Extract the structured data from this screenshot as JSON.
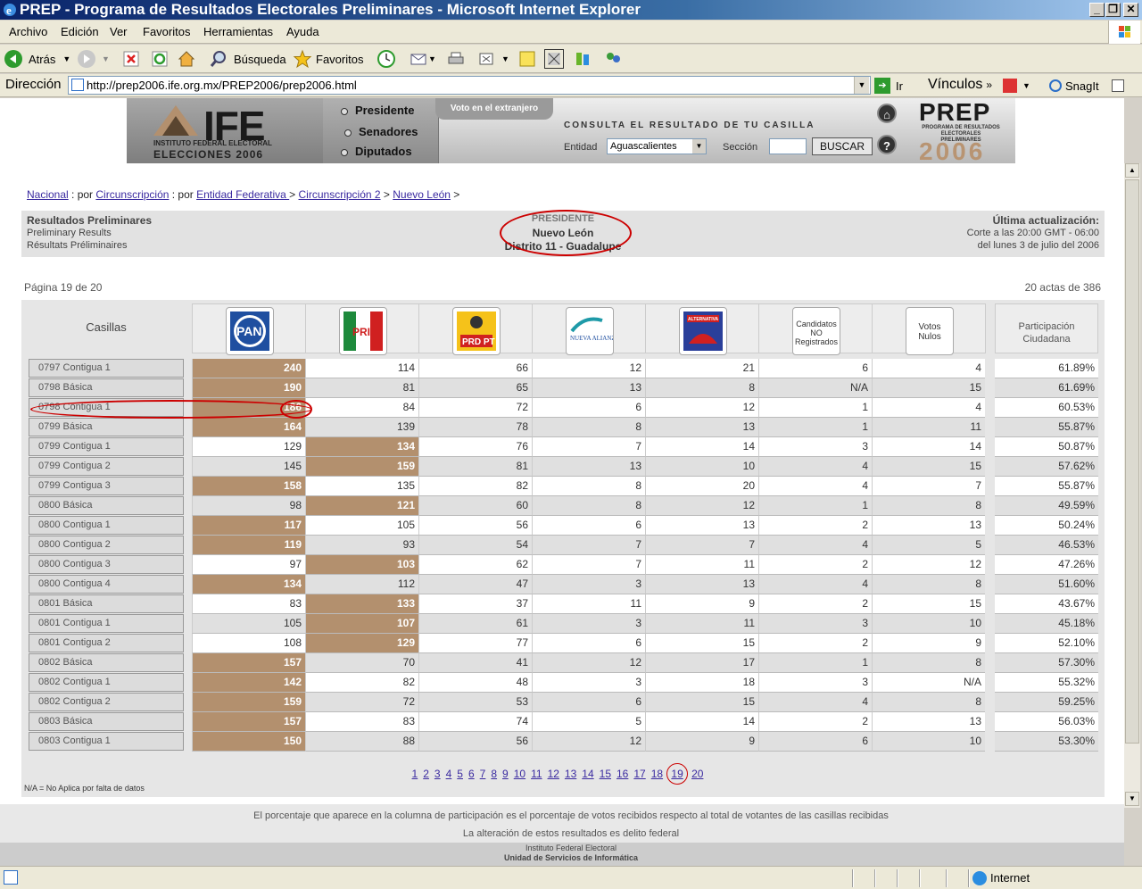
{
  "window": {
    "title": "PREP - Programa de Resultados Electorales Preliminares - Microsoft Internet Explorer"
  },
  "menu": [
    "Archivo",
    "Edición",
    "Ver",
    "Favoritos",
    "Herramientas",
    "Ayuda"
  ],
  "toolbar": {
    "back": "Atrás",
    "search": "Búsqueda",
    "favorites": "Favoritos",
    "go": "Ir",
    "links": "Vínculos",
    "snagit": "SnagIt"
  },
  "address": {
    "label": "Dirección",
    "url": "http://prep2006.ife.org.mx/PREP2006/prep2006.html"
  },
  "banner": {
    "logo": "IFE",
    "logo_sub": "INSTITUTO FEDERAL ELECTORAL",
    "logo_year": "ELECCIONES 2006",
    "nav": [
      "Presidente",
      "Senadores",
      "Diputados"
    ],
    "voto_tab": "Voto en el extranjero",
    "consulta": "CONSULTA EL RESULTADO DE TU CASILLA",
    "entidad_label": "Entidad",
    "entidad_value": "Aguascalientes",
    "seccion_label": "Sección",
    "buscar": "BUSCAR",
    "prep": "PREP",
    "prep_sub": "PROGRAMA DE RESULTADOS ELECTORALES PRELIMINARES",
    "prep_year": "2006"
  },
  "breadcrumb": {
    "nacional": "Nacional",
    "por1": " : por ",
    "circ": "Circunscripción",
    "por2": " : por ",
    "entidad": "Entidad Federativa ",
    "sep1": " > ",
    "circ2": "Circunscripción 2",
    "sep2": " > ",
    "estado": "Nuevo León",
    "sep3": " >"
  },
  "info": {
    "left1": "Resultados Preliminares",
    "left2": "Preliminary Results",
    "left3": "Résultats Préliminaires",
    "center1": "PRESIDENTE",
    "center2": "Nuevo León",
    "center3": "Distrito 11 - Guadalupe",
    "right1": "Última actualización:",
    "right2": "Corte a las 20:00 GMT - 06:00",
    "right3": "del lunes 3 de julio del 2006"
  },
  "pagina": "Página 19 de 20",
  "actas": "20 actas de 386",
  "table": {
    "casillas_header": "Casillas",
    "party_text_headers": [
      "Candidatos NO Registrados",
      "Votos Nulos"
    ],
    "participacion_header": "Participación Ciudadana",
    "party_logos": [
      "PAN",
      "PRI",
      "PRD PT",
      "NUEVA ALIANZA",
      "ALTERNATIVA"
    ],
    "rows": [
      {
        "casilla": "0797 Contigua 1",
        "v": [
          "240",
          "114",
          "66",
          "12",
          "21",
          "6",
          "4"
        ],
        "win": 0,
        "p": "61.89%"
      },
      {
        "casilla": "0798 Básica",
        "v": [
          "190",
          "81",
          "65",
          "13",
          "8",
          "N/A",
          "15"
        ],
        "win": 0,
        "p": "61.69%"
      },
      {
        "casilla": "0798 Contigua 1",
        "v": [
          "186",
          "84",
          "72",
          "6",
          "12",
          "1",
          "4"
        ],
        "win": 0,
        "p": "60.53%"
      },
      {
        "casilla": "0799 Básica",
        "v": [
          "164",
          "139",
          "78",
          "8",
          "13",
          "1",
          "11"
        ],
        "win": 0,
        "p": "55.87%"
      },
      {
        "casilla": "0799 Contigua 1",
        "v": [
          "129",
          "134",
          "76",
          "7",
          "14",
          "3",
          "14"
        ],
        "win": 1,
        "p": "50.87%"
      },
      {
        "casilla": "0799 Contigua 2",
        "v": [
          "145",
          "159",
          "81",
          "13",
          "10",
          "4",
          "15"
        ],
        "win": 1,
        "p": "57.62%"
      },
      {
        "casilla": "0799 Contigua 3",
        "v": [
          "158",
          "135",
          "82",
          "8",
          "20",
          "4",
          "7"
        ],
        "win": 0,
        "p": "55.87%"
      },
      {
        "casilla": "0800 Básica",
        "v": [
          "98",
          "121",
          "60",
          "8",
          "12",
          "1",
          "8"
        ],
        "win": 1,
        "p": "49.59%"
      },
      {
        "casilla": "0800 Contigua 1",
        "v": [
          "117",
          "105",
          "56",
          "6",
          "13",
          "2",
          "13"
        ],
        "win": 0,
        "p": "50.24%"
      },
      {
        "casilla": "0800 Contigua 2",
        "v": [
          "119",
          "93",
          "54",
          "7",
          "7",
          "4",
          "5"
        ],
        "win": 0,
        "p": "46.53%"
      },
      {
        "casilla": "0800 Contigua 3",
        "v": [
          "97",
          "103",
          "62",
          "7",
          "11",
          "2",
          "12"
        ],
        "win": 1,
        "p": "47.26%"
      },
      {
        "casilla": "0800 Contigua 4",
        "v": [
          "134",
          "112",
          "47",
          "3",
          "13",
          "4",
          "8"
        ],
        "win": 0,
        "p": "51.60%"
      },
      {
        "casilla": "0801 Básica",
        "v": [
          "83",
          "133",
          "37",
          "11",
          "9",
          "2",
          "15"
        ],
        "win": 1,
        "p": "43.67%"
      },
      {
        "casilla": "0801 Contigua 1",
        "v": [
          "105",
          "107",
          "61",
          "3",
          "11",
          "3",
          "10"
        ],
        "win": 1,
        "p": "45.18%"
      },
      {
        "casilla": "0801 Contigua 2",
        "v": [
          "108",
          "129",
          "77",
          "6",
          "15",
          "2",
          "9"
        ],
        "win": 1,
        "p": "52.10%"
      },
      {
        "casilla": "0802 Básica",
        "v": [
          "157",
          "70",
          "41",
          "12",
          "17",
          "1",
          "8"
        ],
        "win": 0,
        "p": "57.30%"
      },
      {
        "casilla": "0802 Contigua 1",
        "v": [
          "142",
          "82",
          "48",
          "3",
          "18",
          "3",
          "N/A"
        ],
        "win": 0,
        "p": "55.32%"
      },
      {
        "casilla": "0802 Contigua 2",
        "v": [
          "159",
          "72",
          "53",
          "6",
          "15",
          "4",
          "8"
        ],
        "win": 0,
        "p": "59.25%"
      },
      {
        "casilla": "0803 Básica",
        "v": [
          "157",
          "83",
          "74",
          "5",
          "14",
          "2",
          "13"
        ],
        "win": 0,
        "p": "56.03%"
      },
      {
        "casilla": "0803 Contigua 1",
        "v": [
          "150",
          "88",
          "56",
          "12",
          "9",
          "6",
          "10"
        ],
        "win": 0,
        "p": "53.30%"
      }
    ]
  },
  "pages": [
    "1",
    "2",
    "3",
    "4",
    "5",
    "6",
    "7",
    "8",
    "9",
    "10",
    "11",
    "12",
    "13",
    "14",
    "15",
    "16",
    "17",
    "18",
    "19",
    "20"
  ],
  "current_page": "19",
  "na_note": "N/A = No Aplica por falta de datos",
  "footer": {
    "line1": "El porcentaje que aparece en la columna de participación es el porcentaje de votos recibidos respecto al total de votantes de las casillas recibidas",
    "line2": "La alteración de estos resultados es delito federal",
    "line3": "Instituto Federal Electoral",
    "line4": "Unidad de Servicios de Informática"
  },
  "status": {
    "zone": "Internet"
  },
  "colors": {
    "winner": "#b3906e",
    "ellipse": "#cc0000",
    "link": "#3a2aa0"
  }
}
